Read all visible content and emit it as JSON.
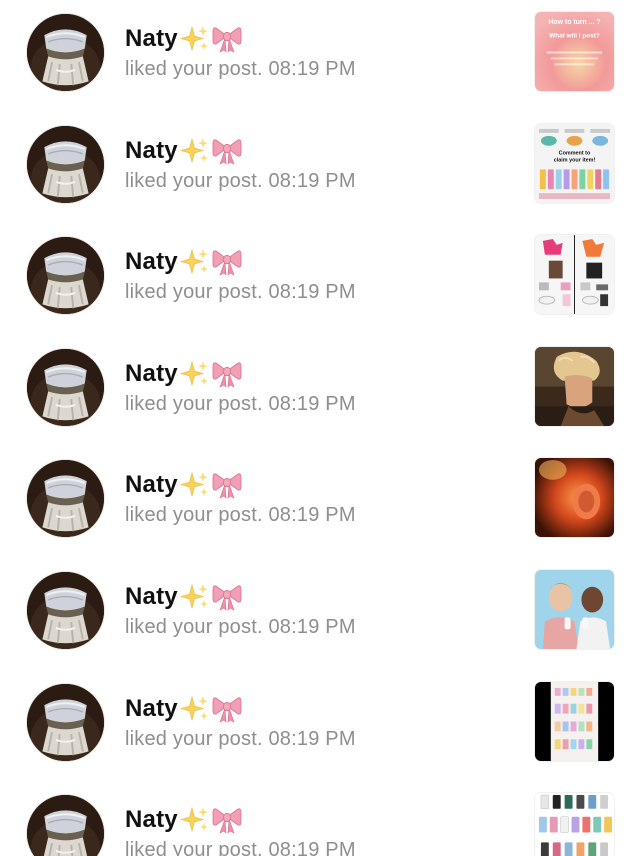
{
  "notifications": [
    {
      "user": "Naty",
      "activity": "liked your post.",
      "time": "08:19 PM",
      "thumb": "thumb-peach-text"
    },
    {
      "user": "Naty",
      "activity": "liked your post.",
      "time": "08:19 PM",
      "thumb": "thumb-cups-giveaway"
    },
    {
      "user": "Naty",
      "activity": "liked your post.",
      "time": "08:19 PM",
      "thumb": "thumb-outfit-grid"
    },
    {
      "user": "Naty",
      "activity": "liked your post.",
      "time": "08:19 PM",
      "thumb": "thumb-blond-man"
    },
    {
      "user": "Naty",
      "activity": "liked your post.",
      "time": "08:19 PM",
      "thumb": "thumb-ear-closeup"
    },
    {
      "user": "Naty",
      "activity": "liked your post.",
      "time": "08:19 PM",
      "thumb": "thumb-two-men"
    },
    {
      "user": "Naty",
      "activity": "liked your post.",
      "time": "08:19 PM",
      "thumb": "thumb-skincare-screen"
    },
    {
      "user": "Naty",
      "activity": "liked your post.",
      "time": "08:19 PM",
      "thumb": "thumb-tumblers-grid"
    }
  ],
  "thumb_text": {
    "peach_line1": "How to turn ... ?",
    "peach_line2": "What will I post?",
    "giveaway_line1": "Comment to",
    "giveaway_line2": "claim your item!"
  },
  "emoji": [
    "sparkles-icon",
    "ribbon-icon"
  ],
  "colors": {
    "name": "#111111",
    "activity": "#8e8e8e",
    "background": "#ffffff"
  }
}
